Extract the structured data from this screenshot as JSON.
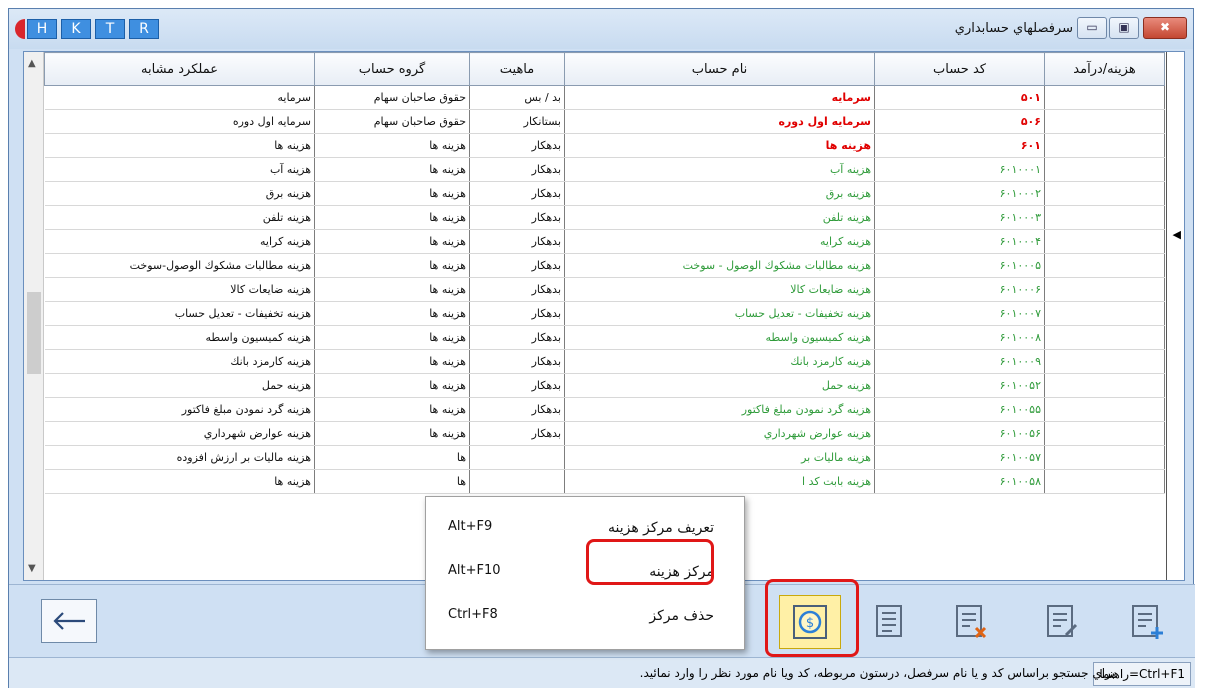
{
  "window": {
    "title": "سرفصلهاي حسابداري",
    "hotkeys": [
      "H",
      "K",
      "T",
      "R"
    ],
    "controls": {
      "close": "✖",
      "max": "▣",
      "min": "▭"
    }
  },
  "table": {
    "headers": {
      "similar": "عملكرد مشابه",
      "group": "گروه حساب",
      "nature": "ماهيت",
      "name": "نام حساب",
      "code": "كد حساب",
      "costrev": "هزينه/درآمد"
    },
    "rows": [
      {
        "similar": "سرمايه",
        "group": "حقوق صاحبان سهام",
        "nature": "بد / بس",
        "name": "سرمايه",
        "code": "۵۰۱",
        "style": "red"
      },
      {
        "similar": "سرمايه اول دوره",
        "group": "حقوق صاحبان سهام",
        "nature": "بستانكار",
        "name": "سرمايه اول دوره",
        "code": "۵۰۶",
        "style": "red"
      },
      {
        "similar": "هزينه ها",
        "group": "هزينه ها",
        "nature": "بدهكار",
        "name": "هزينه ها",
        "code": "۶۰۱",
        "style": "red"
      },
      {
        "similar": "هزينه آب",
        "group": "هزينه ها",
        "nature": "بدهكار",
        "name": "هزينه آب",
        "code": "۶۰۱۰۰۰۱",
        "style": "green"
      },
      {
        "similar": "هزينه برق",
        "group": "هزينه ها",
        "nature": "بدهكار",
        "name": "هزينه برق",
        "code": "۶۰۱۰۰۰۲",
        "style": "green"
      },
      {
        "similar": "هزينه تلفن",
        "group": "هزينه ها",
        "nature": "بدهكار",
        "name": "هزينه تلفن",
        "code": "۶۰۱۰۰۰۳",
        "style": "green"
      },
      {
        "similar": "هزينه كرايه",
        "group": "هزينه ها",
        "nature": "بدهكار",
        "name": "هزينه كرايه",
        "code": "۶۰۱۰۰۰۴",
        "style": "green"
      },
      {
        "similar": "هزينه مطالبات مشكوك الوصول-سوخت",
        "group": "هزينه ها",
        "nature": "بدهكار",
        "name": "هزينه مطالبات مشكوك الوصول - سوخت",
        "code": "۶۰۱۰۰۰۵",
        "style": "green"
      },
      {
        "similar": "هزينه ضايعات كالا",
        "group": "هزينه ها",
        "nature": "بدهكار",
        "name": "هزينه ضايعات كالا",
        "code": "۶۰۱۰۰۰۶",
        "style": "green"
      },
      {
        "similar": "هزينه تخفيفات - تعديل حساب",
        "group": "هزينه ها",
        "nature": "بدهكار",
        "name": "هزينه تخفيفات - تعديل حساب",
        "code": "۶۰۱۰۰۰۷",
        "style": "green"
      },
      {
        "similar": "هزينه كميسيون واسطه",
        "group": "هزينه ها",
        "nature": "بدهكار",
        "name": "هزينه كميسيون واسطه",
        "code": "۶۰۱۰۰۰۸",
        "style": "green"
      },
      {
        "similar": "هزينه كارمزد بانك",
        "group": "هزينه ها",
        "nature": "بدهكار",
        "name": "هزينه كارمزد بانك",
        "code": "۶۰۱۰۰۰۹",
        "style": "green"
      },
      {
        "similar": "هزينه حمل",
        "group": "هزينه ها",
        "nature": "بدهكار",
        "name": "هزينه حمل",
        "code": "۶۰۱۰۰۵۲",
        "style": "green"
      },
      {
        "similar": "هزينه گرد نمودن مبلغ فاكتور",
        "group": "هزينه ها",
        "nature": "بدهكار",
        "name": "هزينه گرد نمودن مبلغ فاكتور",
        "code": "۶۰۱۰۰۵۵",
        "style": "green"
      },
      {
        "similar": "هزينه عوارض شهرداري",
        "group": "هزينه ها",
        "nature": "بدهكار",
        "name": "هزينه عوارض شهرداري",
        "code": "۶۰۱۰۰۵۶",
        "style": "green"
      },
      {
        "similar": "هزينه ماليات بر ارزش افزوده",
        "group": "ها",
        "nature": "",
        "name": "هزينه ماليات بر",
        "code": "۶۰۱۰۰۵۷",
        "style": "green"
      },
      {
        "similar": "هزينه ها",
        "group": "ها",
        "nature": "",
        "name": "هزينه بابت كد ا",
        "code": "۶۰۱۰۰۵۸",
        "style": "green"
      }
    ]
  },
  "context_menu": {
    "items": [
      {
        "label": "تعريف مركز هزينه",
        "shortcut": "Alt+F9"
      },
      {
        "label": "مركز هزينه",
        "shortcut": "Alt+F10"
      },
      {
        "label": "حذف مركز",
        "shortcut": "Ctrl+F8"
      }
    ]
  },
  "toolbar": {
    "icons": [
      "back-arrow-icon",
      "cost-center-coin-icon",
      "report-book-icon",
      "delete-document-icon",
      "edit-document-icon",
      "add-document-icon"
    ]
  },
  "status": {
    "hint": "براي جستجو براساس كد و يا نام سرفصل، درستون مربوطه، كد ويا نام مورد نظر را وارد نمائيد.",
    "shortcut": "راهنما=Ctrl+F1"
  },
  "colors": {
    "highlight": "#e01717",
    "debit_green": "#2f9b3a",
    "header_red": "#e00000",
    "selected_button": "#fff0a6"
  }
}
